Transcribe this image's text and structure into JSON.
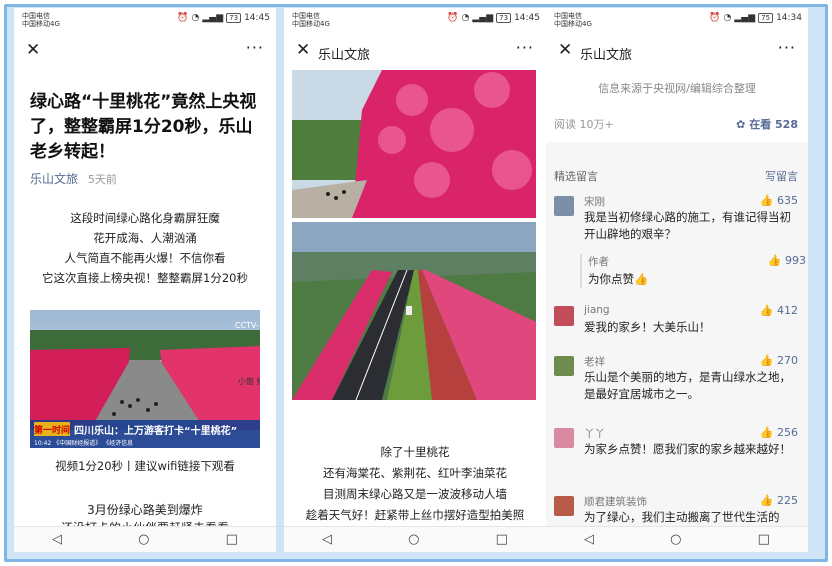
{
  "status": {
    "carrier1": "中国电信",
    "carrier2": "中国移动4G",
    "panels": [
      {
        "battery": "73",
        "time": "14:45"
      },
      {
        "battery": "73",
        "time": "14:45"
      },
      {
        "battery": "75",
        "time": "14:34"
      }
    ]
  },
  "nav": {
    "close": "✕",
    "more": "···",
    "title2": "乐山文旅",
    "title3": "乐山文旅"
  },
  "article": {
    "title": "绿心路“十里桃花”竟然上央视了，整整霸屏1分20秒，乐山老乡转起！",
    "account": "乐山文旅",
    "time": "5天前",
    "intro": [
      "这段时间绿心路化身霸屏狂魔",
      "花开成海、人潮汹涌",
      "人气简直不能再火爆！不信你看",
      "它这次直接上榜央视！整整霸屏1分20秒"
    ],
    "tv": {
      "channel": "CCTV-1",
      "logo_text": "中国\n新闻",
      "small_window": "小窗\n播放",
      "banner_main": "四川乐山：上万游客打卡“十里桃花”",
      "banner_sub": "第一时间",
      "banner_bottom": "10:42  《中国财经报道》        《经济信息"
    },
    "caption": "视频1分20秒丨建议wifi链接下观看",
    "para_title": "3月份绿心路美到爆炸",
    "cut_line": "还没打卡的小伙伴要赶紧去看看"
  },
  "panel2": {
    "lines": [
      "除了十里桃花",
      "还有海棠花、紫荆花、红叶李油菜花",
      "目测周末绿心路又是一波波移动人墙",
      "趁着天气好！赶紧带上丝巾摆好造型拍美照"
    ]
  },
  "panel3": {
    "source": "信息来源于央视网/编辑综合整理",
    "reads": "阅读 10万+",
    "watch": "在看 528",
    "section": "精选留言",
    "write": "写留言",
    "comments": [
      {
        "name": "宋刚",
        "likes": "635",
        "text": "我是当初修绿心路的施工，有谁记得当初开山辟地的艰辛？",
        "avatar": "#7c8fa8"
      },
      {
        "name": "jiang",
        "likes": "412",
        "text": "爱我的家乡！大美乐山！",
        "avatar": "#c24d5a"
      },
      {
        "name": "老祥",
        "likes": "270",
        "text": "乐山是个美丽的地方，是青山绿水之地，是最好宜居城市之一。",
        "avatar": "#6f8b4d"
      },
      {
        "name": "丫丫",
        "likes": "256",
        "text": "为家乡点赞！愿我们家的家乡越来越好！",
        "avatar": "#d98aa0"
      },
      {
        "name": "顺君建筑装饰",
        "likes": "225",
        "text": "为了绿心，我们主动搬离了世代生活的",
        "avatar": "#b85a48"
      }
    ],
    "reply": {
      "name": "作者",
      "likes": "993",
      "text": "为你点赞👍"
    }
  },
  "bottom": {
    "back": "◁",
    "home": "○",
    "recent": "□"
  }
}
